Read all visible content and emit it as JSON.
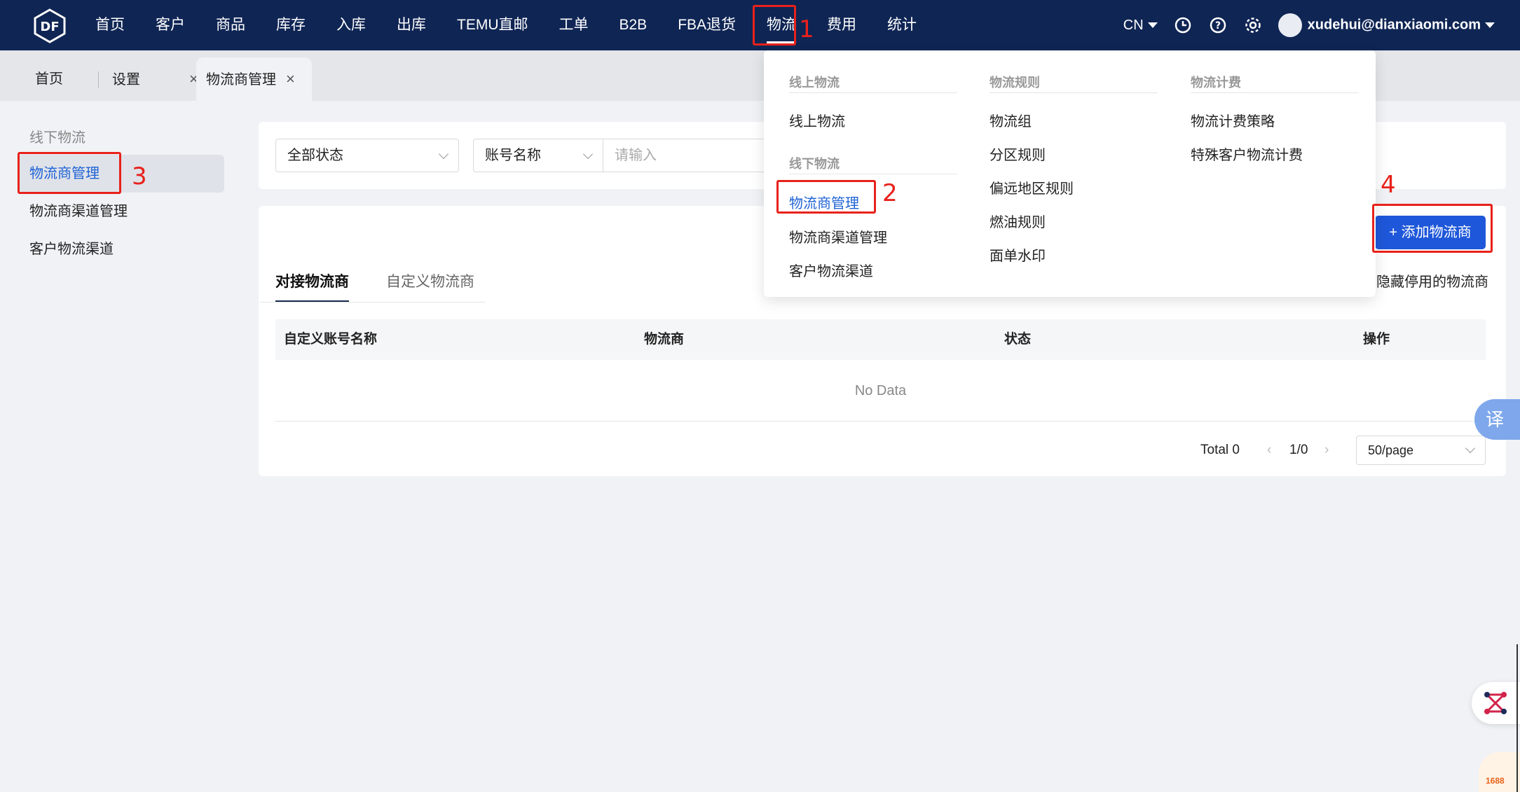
{
  "nav": {
    "items": [
      "首页",
      "客户",
      "商品",
      "库存",
      "入库",
      "出库",
      "TEMU直邮",
      "工单",
      "B2B",
      "FBA退货",
      "物流",
      "费用",
      "统计"
    ],
    "active_index": 10,
    "lang": "CN",
    "user": "xudehui@dianxiaomi.com"
  },
  "tabs": [
    {
      "label": "首页"
    },
    {
      "label": "设置",
      "close": "×"
    },
    {
      "label": "物流商管理",
      "close": "×"
    }
  ],
  "sidebar": {
    "group": "线下物流",
    "items": [
      "物流商管理",
      "物流商渠道管理",
      "客户物流渠道"
    ]
  },
  "filters": {
    "status": "全部状态",
    "field": "账号名称",
    "search_placeholder": "请输入"
  },
  "content_tabs": [
    "对接物流商",
    "自定义物流商"
  ],
  "add_button": "+ 添加物流商",
  "hide_label": "隐藏停用的物流商",
  "table": {
    "headers": [
      "自定义账号名称",
      "物流商",
      "状态",
      "操作"
    ],
    "empty": "No Data"
  },
  "pager": {
    "total": "Total 0",
    "pages": "1/0",
    "page_size": "50/page"
  },
  "menu": {
    "col1": {
      "head1": "线上物流",
      "items1": [
        "线上物流"
      ],
      "head2": "线下物流",
      "items2": [
        "物流商管理",
        "物流商渠道管理",
        "客户物流渠道"
      ]
    },
    "col2": {
      "head": "物流规则",
      "items": [
        "物流组",
        "分区规则",
        "偏远地区规则",
        "燃油规则",
        "面单水印"
      ]
    },
    "col3": {
      "head": "物流计费",
      "items": [
        "物流计费策略",
        "特殊客户物流计费"
      ]
    }
  },
  "annotations": [
    "1",
    "2",
    "3",
    "4"
  ],
  "widgets": {
    "translate": "译",
    "brand_1688": "1688"
  },
  "colors": {
    "nav_bg": "#0f2554",
    "accent": "#1e57d9",
    "annotation": "#e8211b"
  }
}
